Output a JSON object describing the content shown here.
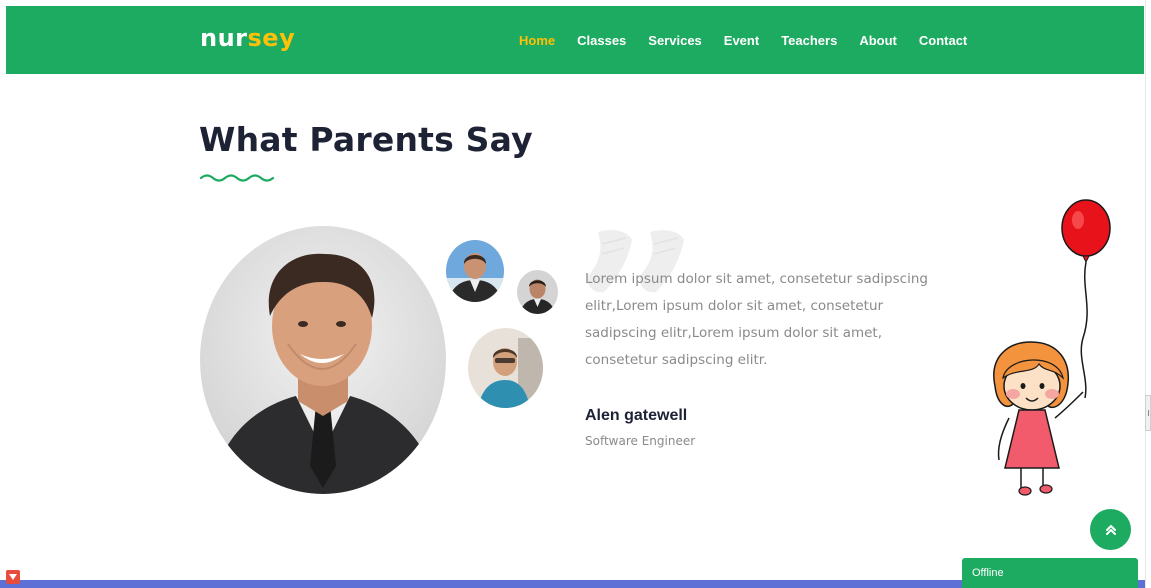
{
  "brand": {
    "logo_part1": "nur",
    "logo_part2": "sey"
  },
  "nav": [
    {
      "label": "Home",
      "active": true
    },
    {
      "label": "Classes"
    },
    {
      "label": "Services"
    },
    {
      "label": "Event"
    },
    {
      "label": "Teachers"
    },
    {
      "label": "About"
    },
    {
      "label": "Contact"
    }
  ],
  "section": {
    "title": "What Parents Say"
  },
  "testimonial": {
    "text": "Lorem ipsum dolor sit amet, consetetur sadipscing elitr,Lorem ipsum dolor sit amet, consetetur sadipscing elitr,Lorem ipsum dolor sit amet, consetetur sadipscing elitr.",
    "author": "Alen gatewell",
    "role": "Software Engineer"
  },
  "chat": {
    "status": "Offline"
  },
  "colors": {
    "primary": "#1daa61",
    "accent": "#ffc107",
    "heading": "#1e2235",
    "body_text": "#8a8a8a",
    "balloon": "#e8131a"
  },
  "icons": {
    "scroll_top": "double-chevron-up-icon",
    "quote": "quote-icon",
    "wave": "wave-divider-icon"
  }
}
